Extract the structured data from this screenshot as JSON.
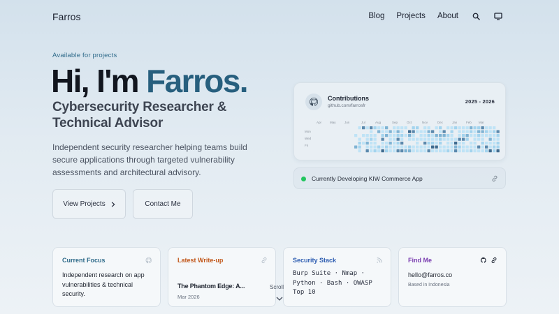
{
  "nav": {
    "brand": "Farros",
    "links": [
      "Blog",
      "Projects",
      "About"
    ],
    "icons": [
      "search-icon",
      "monitor-icon"
    ]
  },
  "hero": {
    "eyebrow": "Available for projects",
    "greeting": "Hi, I'm ",
    "name": "Farros.",
    "subtitle": "Cybersecurity Researcher & Technical Advisor",
    "description": "Independent security researcher helping teams build secure applications through targeted vulnerability assessments and architectural advisory.",
    "primary_button": "View Projects",
    "secondary_button": "Contact Me"
  },
  "contributions": {
    "title": "Contributions",
    "url": "github.com/farrosfr",
    "range": "2025 - 2026",
    "months": [
      "Apr",
      "May",
      "Jun",
      "Jul",
      "Aug",
      "Sep",
      "Oct",
      "Nov",
      "Dec",
      "Jan",
      "Feb",
      "Mar"
    ],
    "days": [
      "Mon",
      "Wed",
      "Fri"
    ]
  },
  "status": {
    "text": "Currently Developing KIW Commerce App"
  },
  "cards": {
    "focus": {
      "title": "Current Focus",
      "body": "Independent research on app vulnerabilities & technical security."
    },
    "writeup": {
      "title": "Latest Write-up",
      "headline": "The Phantom Edge: A...",
      "date": "Mar 2026"
    },
    "stack": {
      "title": "Security Stack",
      "body": "Burp Suite · Nmap · Python · Bash · OWASP Top 10"
    },
    "findme": {
      "title": "Find Me",
      "email": "hello@farros.co",
      "location": "Based in Indonesia"
    }
  },
  "scroll_label": "Scroll",
  "colors": {
    "accent": "#275f7e",
    "focus_title": "#2f6b8a",
    "writeup_title": "#c2571a",
    "stack_title": "#2b5bb0",
    "findme_title": "#7a3db0",
    "status_dot": "#22c55e"
  }
}
